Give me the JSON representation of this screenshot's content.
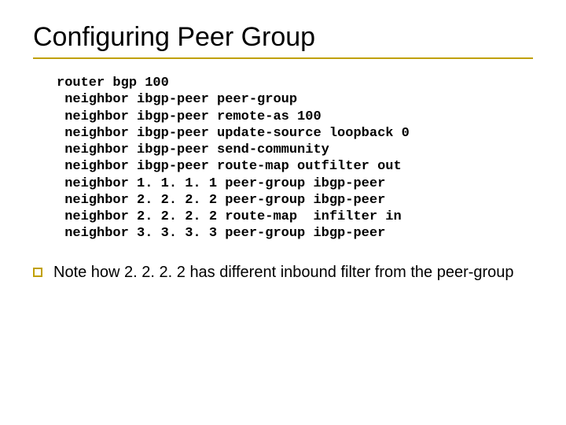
{
  "title": "Configuring Peer Group",
  "code": "router bgp 100\n neighbor ibgp-peer peer-group\n neighbor ibgp-peer remote-as 100\n neighbor ibgp-peer update-source loopback 0\n neighbor ibgp-peer send-community\n neighbor ibgp-peer route-map outfilter out\n neighbor 1. 1. 1. 1 peer-group ibgp-peer\n neighbor 2. 2. 2. 2 peer-group ibgp-peer\n neighbor 2. 2. 2. 2 route-map  infilter in\n neighbor 3. 3. 3. 3 peer-group ibgp-peer",
  "note": "Note how 2. 2. 2. 2 has different inbound filter from the peer-group"
}
